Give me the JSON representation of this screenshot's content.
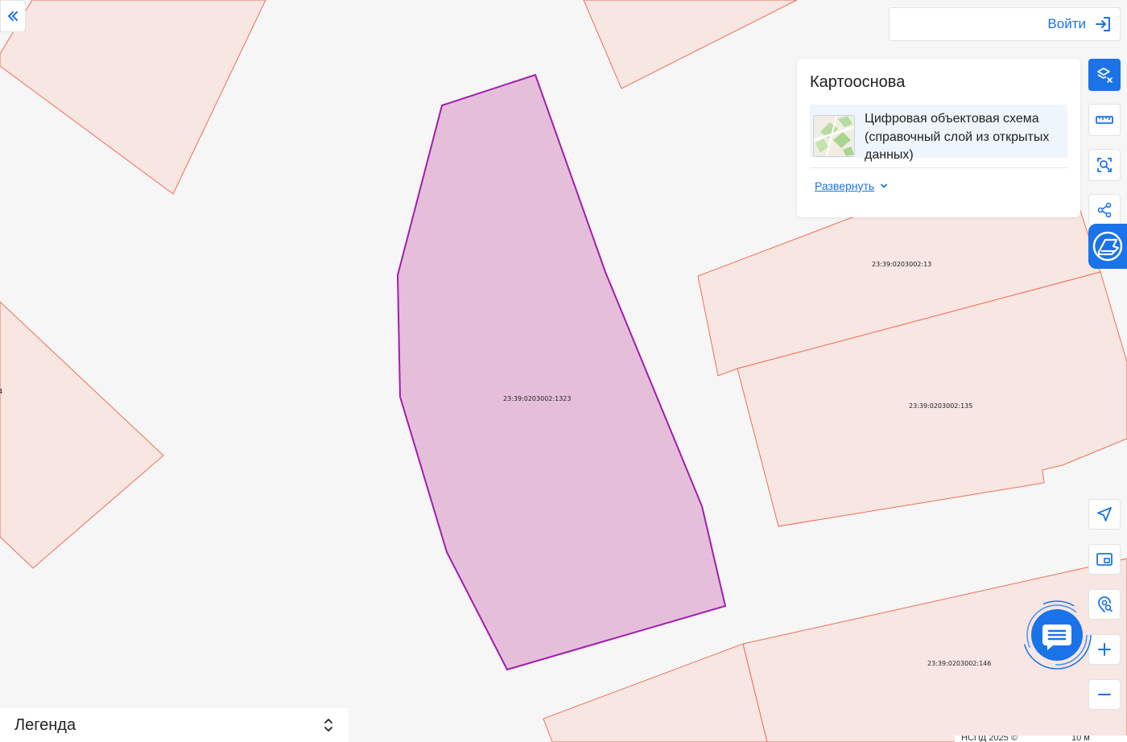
{
  "parcels": {
    "selected": "23:39:0203002:1323",
    "p13": "23:39:0203002:13",
    "p135": "23:39:0203002:135",
    "p146": "23:39:0203002:146",
    "left_partial": "4"
  },
  "header": {
    "login_label": "Войти"
  },
  "basemap": {
    "title": "Картооснова",
    "item_label": "Цифровая объектовая схема (справочный слой из открытых данных)",
    "expand_label": "Развернуть"
  },
  "legend": {
    "label": "Легенда"
  },
  "footer": {
    "attribution": "НСПД 2025 ©",
    "scale": "10 м"
  },
  "colors": {
    "accent": "#1a73e8",
    "parcel_fill": "#f7e6e2",
    "parcel_stroke": "#ef6f57",
    "selected_fill": "#e5bfd9",
    "selected_stroke": "#a21caf"
  },
  "icons": {
    "collapse": "double-chevron-left-icon",
    "login": "login-arrow-icon",
    "layers": "layers-off-icon",
    "ruler": "ruler-icon",
    "area_select": "area-search-icon",
    "share": "share-icon",
    "brand": "nspd-brand-icon",
    "locate": "navigation-arrow-icon",
    "minimap": "minimap-icon",
    "location_search": "location-search-icon",
    "zoom_in": "plus-icon",
    "zoom_out": "minus-icon",
    "chat": "chat-icon"
  }
}
